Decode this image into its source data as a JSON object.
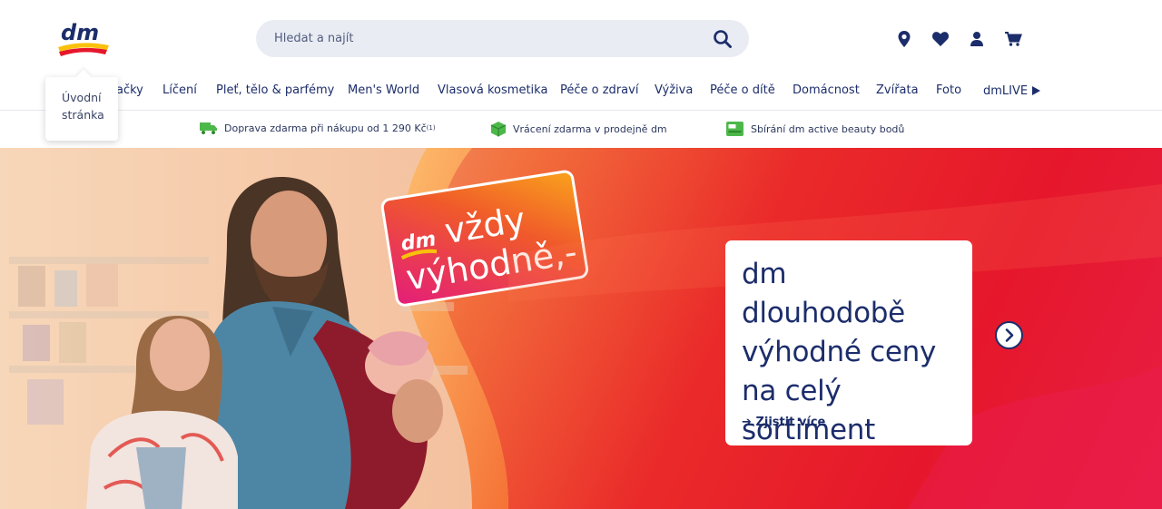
{
  "header": {
    "logo_text": "dm",
    "search": {
      "placeholder": "Hledat a najít",
      "value": ""
    },
    "icons": [
      "location-icon",
      "heart-icon",
      "account-icon",
      "cart-icon"
    ]
  },
  "nav": {
    "items": [
      {
        "label": "ačky"
      },
      {
        "label": "Líčení"
      },
      {
        "label": "Pleť, tělo & parfémy"
      },
      {
        "label": "Men's World"
      },
      {
        "label": "Vlasová kosmetika"
      },
      {
        "label": "Péče o zdraví"
      },
      {
        "label": "Výživa"
      },
      {
        "label": "Péče o dítě"
      },
      {
        "label": "Domácnost"
      },
      {
        "label": "Zvířata"
      },
      {
        "label": "Foto"
      },
      {
        "label": "dmLIVE"
      }
    ],
    "tooltip": "Úvodní stránka"
  },
  "benefits": [
    {
      "text": "Doprava zdarma při nákupu od 1 290 Kč",
      "sup": "(1)",
      "icon": "truck-icon"
    },
    {
      "text": "Vrácení zdarma v prodejně dm",
      "sup": "",
      "icon": "package-icon"
    },
    {
      "text": "Sbírání dm active beauty bodů",
      "sup": "",
      "icon": "loyalty-card-icon"
    }
  ],
  "hero": {
    "badge_brand": "dm",
    "badge_line1": "vždy",
    "badge_line2": "výhodně,-",
    "card_title": "dm dlouhodobě výhodné ceny na celý sortiment",
    "card_link": "Zjistit více"
  },
  "colors": {
    "brand_navy": "#1c2d6b",
    "brand_red": "#e6172b",
    "brand_yellow": "#f9c10b",
    "green_icon": "#4cb84a"
  }
}
